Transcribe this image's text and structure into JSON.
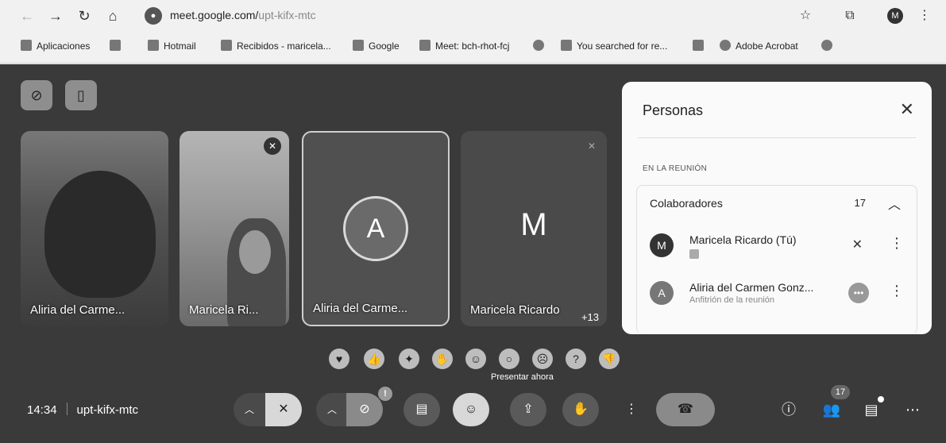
{
  "browser": {
    "url_host": "meet.google.com/",
    "url_path": "upt-kifx-mtc",
    "profile_initial": "M",
    "bookmarks": [
      {
        "label": "Aplicaciones"
      },
      {
        "label": "Hotmail"
      },
      {
        "label": "Recibidos - maricela..."
      },
      {
        "label": "Google"
      },
      {
        "label": "Meet: bch-rhot-fcj"
      },
      {
        "label": "You searched for re..."
      },
      {
        "label": "Adobe Acrobat"
      }
    ]
  },
  "tiles": [
    {
      "name": "Aliria del Carme..."
    },
    {
      "name": "Maricela Ri..."
    },
    {
      "name": "Aliria del Carme...",
      "initial": "A"
    },
    {
      "name": "Maricela Ricardo",
      "initial": "M",
      "extra": "+13"
    }
  ],
  "panel": {
    "title": "Personas",
    "section": "EN LA REUNIÓN",
    "group_label": "Colaboradores",
    "group_count": "17",
    "people": [
      {
        "initial": "M",
        "name": "Maricela Ricardo (Tú)",
        "sub": ""
      },
      {
        "initial": "A",
        "name": "Aliria del Carmen Gonz...",
        "sub": "Anfitrión de la reunión"
      }
    ]
  },
  "reactions_tooltip": "Presentar ahora",
  "footer": {
    "time": "14:34",
    "meeting_code": "upt-kifx-mtc",
    "participants_badge": "17"
  },
  "colors": {
    "meet_bg": "#3a3a3a",
    "panel_bg": "#fafafa"
  }
}
